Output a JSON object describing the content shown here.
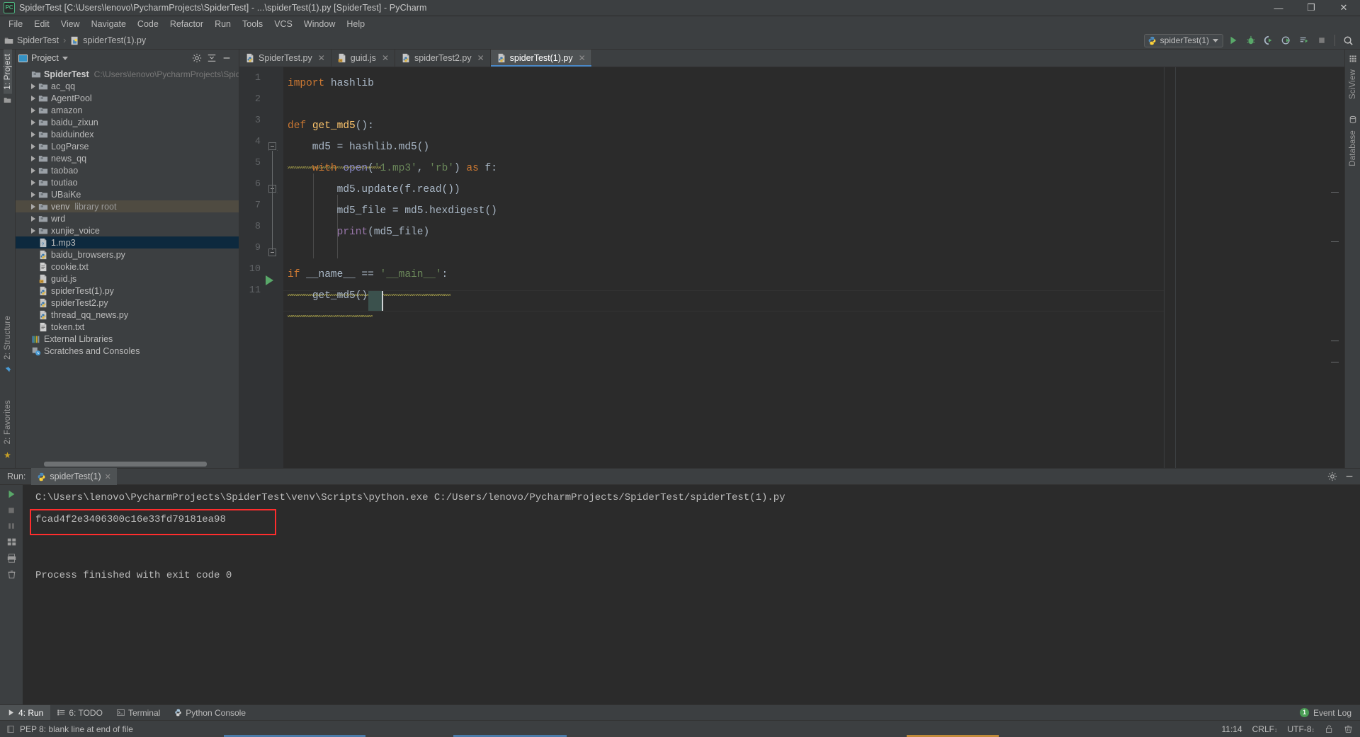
{
  "window": {
    "title": "SpiderTest [C:\\Users\\lenovo\\PycharmProjects\\SpiderTest] - ...\\spiderTest(1).py [SpiderTest] - PyCharm",
    "app_icon": "pycharm-icon",
    "minimize": "—",
    "maximize": "❐",
    "close": "✕"
  },
  "menubar": {
    "items": [
      {
        "label": "File"
      },
      {
        "label": "Edit"
      },
      {
        "label": "View"
      },
      {
        "label": "Navigate"
      },
      {
        "label": "Code"
      },
      {
        "label": "Refactor"
      },
      {
        "label": "Run"
      },
      {
        "label": "Tools"
      },
      {
        "label": "VCS"
      },
      {
        "label": "Window"
      },
      {
        "label": "Help"
      }
    ]
  },
  "navbar": {
    "crumbs": [
      {
        "label": "SpiderTest",
        "icon": "folder-icon"
      },
      {
        "label": "spiderTest(1).py",
        "icon": "python-file-icon"
      }
    ],
    "separator": "›",
    "run_config": {
      "label": "spiderTest(1)",
      "icon": "python-icon",
      "caret": "▾"
    },
    "buttons": [
      {
        "name": "run-button",
        "glyph": "▶"
      },
      {
        "name": "debug-button",
        "glyph": "🐞"
      },
      {
        "name": "run-coverage-button",
        "glyph": "◗"
      },
      {
        "name": "profile-button",
        "glyph": "◔"
      },
      {
        "name": "run-with-options-button",
        "glyph": "≡"
      },
      {
        "name": "stop-button",
        "glyph": "■"
      },
      {
        "name": "search-everywhere-button",
        "glyph": "⚲"
      }
    ]
  },
  "left_strip": {
    "project_label": "1: Project",
    "structure_label": "2: Structure",
    "favorites_label": "2: Favorites",
    "star": "★"
  },
  "right_strip": {
    "sciview_label": "SciView",
    "database_label": "Database"
  },
  "project_panel": {
    "title": "Project",
    "caret": "▾",
    "settings_icon": "gear-icon",
    "collapse_icon": "collapse-all-icon",
    "hide_icon": "hide-icon",
    "tree": [
      {
        "label": "SpiderTest",
        "suffix": "C:\\Users\\lenovo\\PycharmProjects\\Spid",
        "type": "root",
        "depth": 0,
        "icon": "folder-icon",
        "arrow": false,
        "bold": true
      },
      {
        "label": "ac_qq",
        "type": "folder",
        "depth": 1,
        "icon": "folder-icon",
        "arrow": true
      },
      {
        "label": "AgentPool",
        "type": "folder",
        "depth": 1,
        "icon": "folder-icon",
        "arrow": true
      },
      {
        "label": "amazon",
        "type": "folder",
        "depth": 1,
        "icon": "folder-icon",
        "arrow": true
      },
      {
        "label": "baidu_zixun",
        "type": "folder",
        "depth": 1,
        "icon": "folder-icon",
        "arrow": true
      },
      {
        "label": "baiduindex",
        "type": "folder",
        "depth": 1,
        "icon": "folder-icon",
        "arrow": true
      },
      {
        "label": "LogParse",
        "type": "folder",
        "depth": 1,
        "icon": "folder-icon",
        "arrow": true
      },
      {
        "label": "news_qq",
        "type": "folder",
        "depth": 1,
        "icon": "folder-icon",
        "arrow": true
      },
      {
        "label": "taobao",
        "type": "folder",
        "depth": 1,
        "icon": "folder-icon",
        "arrow": true
      },
      {
        "label": "toutiao",
        "type": "folder",
        "depth": 1,
        "icon": "folder-icon",
        "arrow": true
      },
      {
        "label": "UBaiKe",
        "type": "folder",
        "depth": 1,
        "icon": "folder-icon",
        "arrow": true
      },
      {
        "label": "venv",
        "suffix": "library root",
        "type": "folder",
        "depth": 1,
        "icon": "folder-icon",
        "arrow": true,
        "highlight": "library"
      },
      {
        "label": "wrd",
        "type": "folder",
        "depth": 1,
        "icon": "folder-icon",
        "arrow": true
      },
      {
        "label": "xunjie_voice",
        "type": "folder",
        "depth": 1,
        "icon": "folder-icon",
        "arrow": true
      },
      {
        "label": "1.mp3",
        "type": "file",
        "depth": 1,
        "icon": "unknown-file-icon",
        "arrow": false,
        "selected": true
      },
      {
        "label": "baidu_browsers.py",
        "type": "file",
        "depth": 1,
        "icon": "python-file-icon",
        "arrow": false
      },
      {
        "label": "cookie.txt",
        "type": "file",
        "depth": 1,
        "icon": "text-file-icon",
        "arrow": false
      },
      {
        "label": "guid.js",
        "type": "file",
        "depth": 1,
        "icon": "js-file-icon",
        "arrow": false
      },
      {
        "label": "spiderTest(1).py",
        "type": "file",
        "depth": 1,
        "icon": "python-file-icon",
        "arrow": false
      },
      {
        "label": "spiderTest2.py",
        "type": "file",
        "depth": 1,
        "icon": "python-file-icon",
        "arrow": false
      },
      {
        "label": "thread_qq_news.py",
        "type": "file",
        "depth": 1,
        "icon": "python-file-icon",
        "arrow": false
      },
      {
        "label": "token.txt",
        "type": "file",
        "depth": 1,
        "icon": "text-file-icon",
        "arrow": false
      },
      {
        "label": "External Libraries",
        "type": "node",
        "depth": 0,
        "icon": "libraries-icon",
        "arrow": false
      },
      {
        "label": "Scratches and Consoles",
        "type": "node",
        "depth": 0,
        "icon": "scratches-icon",
        "arrow": false
      }
    ]
  },
  "editor": {
    "tabs": [
      {
        "label": "SpiderTest.py",
        "icon": "python-file-icon",
        "active": false,
        "close": "✕"
      },
      {
        "label": "guid.js",
        "icon": "js-file-icon",
        "active": false,
        "close": "✕"
      },
      {
        "label": "spiderTest2.py",
        "icon": "python-file-icon",
        "active": false,
        "close": "✕"
      },
      {
        "label": "spiderTest(1).py",
        "icon": "python-file-icon",
        "active": true,
        "close": "✕"
      }
    ],
    "line_numbers": [
      "1",
      "2",
      "3",
      "4",
      "5",
      "6",
      "7",
      "8",
      "9",
      "10",
      "11"
    ],
    "lines": [
      {
        "n": 1,
        "tokens": [
          {
            "t": "import",
            "c": "kw"
          },
          {
            "t": " hashlib",
            "c": "plain"
          }
        ]
      },
      {
        "n": 2,
        "tokens": []
      },
      {
        "n": 3,
        "tokens": [
          {
            "t": "def",
            "c": "kw"
          },
          {
            "t": " ",
            "c": "plain"
          },
          {
            "t": "get_md5",
            "c": "fn"
          },
          {
            "t": "():",
            "c": "plain"
          }
        ]
      },
      {
        "n": 4,
        "tokens": [
          {
            "t": "    md5 = hashlib.md5()",
            "c": "plain"
          }
        ]
      },
      {
        "n": 5,
        "tokens": [
          {
            "t": "    ",
            "c": "plain"
          },
          {
            "t": "with",
            "c": "kw"
          },
          {
            "t": " ",
            "c": "plain"
          },
          {
            "t": "open",
            "c": "builtin"
          },
          {
            "t": "(",
            "c": "plain"
          },
          {
            "t": "'1.mp3'",
            "c": "str"
          },
          {
            "t": ", ",
            "c": "plain"
          },
          {
            "t": "'rb'",
            "c": "str"
          },
          {
            "t": ") ",
            "c": "plain"
          },
          {
            "t": "as",
            "c": "kw"
          },
          {
            "t": " f:",
            "c": "plain"
          }
        ]
      },
      {
        "n": 6,
        "tokens": [
          {
            "t": "        md5.update(f.read())",
            "c": "plain"
          }
        ]
      },
      {
        "n": 7,
        "tokens": [
          {
            "t": "        md5_file = md5.hexdigest()",
            "c": "plain"
          }
        ]
      },
      {
        "n": 8,
        "tokens": [
          {
            "t": "        ",
            "c": "plain"
          },
          {
            "t": "print",
            "c": "pink"
          },
          {
            "t": "(md5_file)",
            "c": "plain"
          }
        ]
      },
      {
        "n": 9,
        "tokens": []
      },
      {
        "n": 10,
        "tokens": [
          {
            "t": "if",
            "c": "kw"
          },
          {
            "t": " __name__ == ",
            "c": "plain"
          },
          {
            "t": "'__main__'",
            "c": "str"
          },
          {
            "t": ":",
            "c": "plain"
          }
        ]
      },
      {
        "n": 11,
        "tokens": [
          {
            "t": "    ",
            "c": "plain"
          },
          {
            "t": "get_md5",
            "c": "plain"
          },
          {
            "t": "()",
            "c": "plain"
          }
        ]
      }
    ],
    "raw_text": [
      "import hashlib",
      "",
      "def get_md5():",
      "    md5 = hashlib.md5()",
      "    with open('1.mp3', 'rb') as f:",
      "        md5.update(f.read())",
      "        md5_file = md5.hexdigest()",
      "        print(md5_file)",
      "",
      "if __name__ == '__main__':",
      "    get_md5()"
    ],
    "run_marker_line": 10
  },
  "run_window": {
    "label": "Run:",
    "tab": {
      "label": "spiderTest(1)",
      "icon": "python-icon",
      "close": "✕"
    },
    "settings_icon": "gear-icon",
    "hide_icon": "hide-icon",
    "side_buttons": [
      {
        "name": "rerun-button",
        "glyph": "▶"
      },
      {
        "name": "stop-button",
        "glyph": "■"
      },
      {
        "name": "pause-button",
        "glyph": "‖"
      },
      {
        "name": "up-stack-button",
        "glyph": "↑"
      },
      {
        "name": "down-stack-button",
        "glyph": "↓"
      },
      {
        "name": "soft-wrap-button",
        "glyph": "↵"
      },
      {
        "name": "scroll-to-end-button",
        "glyph": "↧"
      },
      {
        "name": "print-button",
        "glyph": "⎙"
      },
      {
        "name": "clear-all-button",
        "glyph": "🗑"
      }
    ],
    "console_lines": [
      {
        "text": "C:\\Users\\lenovo\\PycharmProjects\\SpiderTest\\venv\\Scripts\\python.exe C:/Users/lenovo/PycharmProjects/SpiderTest/spiderTest(1).py",
        "highlight": false
      },
      {
        "text": "fcad4f2e3406300c16e33fd79181ea98",
        "highlight": true
      },
      {
        "text": "",
        "highlight": false
      },
      {
        "text": "Process finished with exit code 0",
        "highlight": false
      }
    ],
    "highlight_color": "#ff2d2d"
  },
  "bottombar": {
    "items": [
      {
        "label": "4: Run",
        "icon": "run-icon",
        "active": true,
        "mnemonic": "4"
      },
      {
        "label": "6: TODO",
        "icon": "todo-icon",
        "active": false,
        "mnemonic": "6"
      },
      {
        "label": "Terminal",
        "icon": "terminal-icon",
        "active": false
      },
      {
        "label": "Python Console",
        "icon": "python-icon",
        "active": false
      }
    ],
    "event_log": {
      "label": "Event Log",
      "count": "1"
    }
  },
  "statusbar": {
    "message": "PEP 8: blank line at end of file",
    "message_icon": "inspection-icon",
    "time": "11:14",
    "line_separator": "CRLF",
    "encoding": "UTF-8",
    "lock_icon": "unlocked-icon",
    "memory_icon": "gc-icon",
    "arrows": "↕"
  },
  "colors": {
    "accent_blue": "#4a88c7",
    "selection_blue": "#0d293e",
    "library_root": "#4f4b41",
    "green_run": "#59a869",
    "keyword_orange": "#cc7832",
    "string_green": "#6a8759",
    "function_yellow": "#ffc66d",
    "builtin_purple": "#8888c6",
    "editor_bg": "#2b2b2b",
    "panel_bg": "#3c3f41"
  }
}
